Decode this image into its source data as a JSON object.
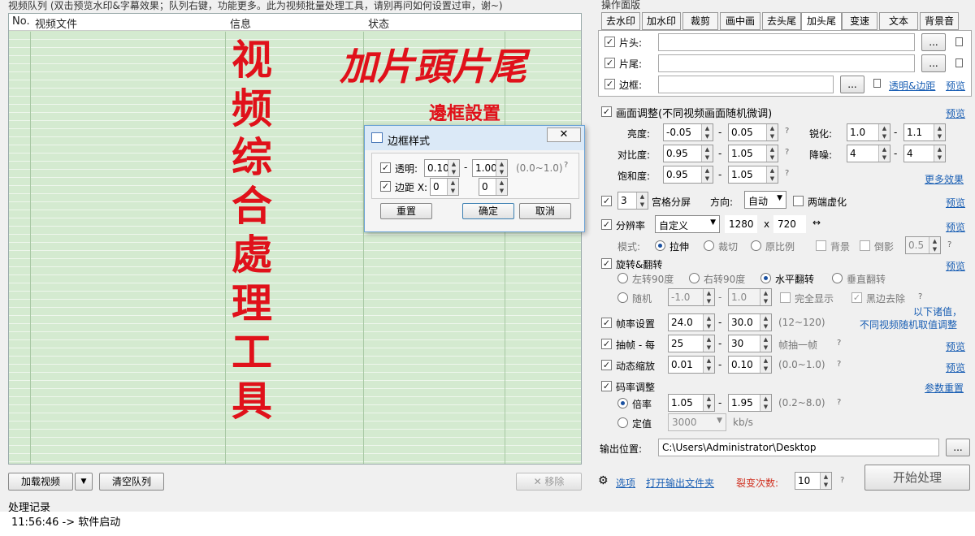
{
  "queue": {
    "title": "视频队列 (双击预览水印&字幕效果；队列右键，功能更多。此为视频批量处理工具，请别再问如何设置过审，谢~)",
    "columns": {
      "no": "No.",
      "file": "视频文件",
      "info": "信息",
      "status": "状态"
    },
    "overlay_vertical": [
      "视",
      "频",
      "综",
      "合",
      "處",
      "理",
      "工",
      "具"
    ],
    "overlay_heading": "加片頭片尾",
    "overlay_sub": "邊框設置"
  },
  "bottom_bar": {
    "load": "加载视频",
    "clear": "清空队列",
    "remove": "✕ 移除"
  },
  "log": {
    "title": "处理记录",
    "entry": "11:56:46 -> 软件启动"
  },
  "dialog": {
    "title": "边框样式",
    "opacity_label": "透明:",
    "opacity_min": "0.10",
    "opacity_max": "1.00",
    "opacity_range": "(0.0~1.0)",
    "margin_label": "边距 X:",
    "margin_x": "0",
    "margin_y": "0",
    "reset": "重置",
    "ok": "确定",
    "cancel": "取消"
  },
  "panel": {
    "title": "操作面版",
    "tabs": [
      "去水印",
      "加水印",
      "裁剪",
      "画中画",
      "去头尾",
      "加头尾",
      "变速",
      "文本",
      "背景音"
    ],
    "head_label": "片头:",
    "tail_label": "片尾:",
    "border_label": "边框:",
    "browse": "...",
    "border_link": "透明&边距",
    "preview": "预览",
    "picture_adjust": "画面调整(不同视频画面随机微调)",
    "brightness": "亮度:",
    "brightness_min": "-0.05",
    "brightness_max": "0.05",
    "sharpen": "锐化:",
    "sharpen_min": "1.0",
    "sharpen_max": "1.1",
    "contrast": "对比度:",
    "contrast_min": "0.95",
    "contrast_max": "1.05",
    "denoise": "降噪:",
    "denoise_min": "4",
    "denoise_max": "4",
    "saturation": "饱和度:",
    "saturation_min": "0.95",
    "saturation_max": "1.05",
    "more_effects": "更多效果",
    "grid_count": "3",
    "grid_label": "宫格分屏",
    "direction_label": "方向:",
    "direction_value": "自动",
    "blur_ends": "两端虚化",
    "resolution_label": "分辨率",
    "resolution_value": "自定义",
    "res_w": "1280",
    "res_x": "x",
    "res_h": "720",
    "mode_label": "模式:",
    "mode_stretch": "拉伸",
    "mode_crop": "裁切",
    "mode_ratio": "原比例",
    "background": "背景",
    "reflection": "倒影",
    "reflection_value": "0.5",
    "rotate_label": "旋转&翻转",
    "rot_left": "左转90度",
    "rot_right": "右转90度",
    "flip_h": "水平翻转",
    "flip_v": "垂直翻转",
    "random": "随机",
    "random_min": "-1.0",
    "random_max": "1.0",
    "full_show": "完全显示",
    "remove_black": "黑边去除",
    "note_line1": "以下诸值，",
    "note_line2": "不同视频随机取值调整",
    "fps_label": "帧率设置",
    "fps_min": "24.0",
    "fps_max": "30.0",
    "fps_range": "(12~120)",
    "drop_label": "抽帧 - 每",
    "drop_min": "25",
    "drop_max": "30",
    "drop_suffix": "帧抽一帧",
    "zoom_label": "动态缩放",
    "zoom_min": "0.01",
    "zoom_max": "0.10",
    "zoom_range": "(0.0~1.0)",
    "bitrate_label": "码率调整",
    "reset_params": "参数重置",
    "rate_mult": "倍率",
    "rate_min": "1.05",
    "rate_max": "1.95",
    "rate_range": "(0.2~8.0)",
    "rate_fixed": "定值",
    "rate_fixed_value": "3000",
    "rate_unit": "kb/s",
    "output_label": "输出位置:",
    "output_path": "C:\\Users\\Administrator\\Desktop",
    "options": "选项",
    "open_output": "打开输出文件夹",
    "split_label": "裂变次数:",
    "split_value": "10",
    "start": "开始处理",
    "dash": "-",
    "q": "?"
  }
}
